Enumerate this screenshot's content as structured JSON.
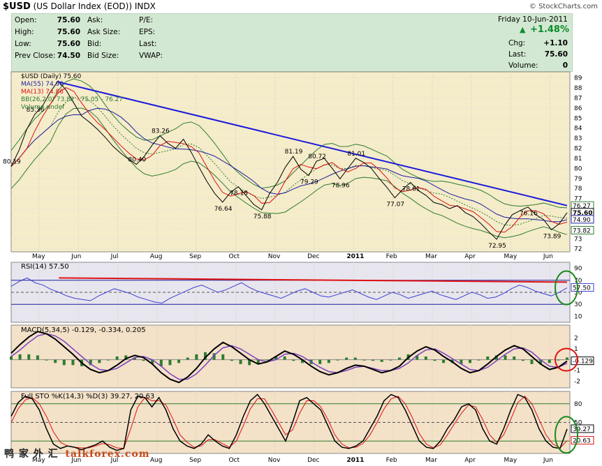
{
  "header": {
    "symbol": "$USD",
    "name": "(US Dollar Index (EOD))",
    "exchange": "INDX",
    "brand": "© StockCharts.com"
  },
  "quote": {
    "date": "Friday  10-Jun-2011",
    "open_label": "Open:",
    "open": "75.60",
    "high_label": "High:",
    "high": "75.60",
    "low_label": "Low:",
    "low": "75.60",
    "prev_close_label": "Prev Close:",
    "prev_close": "74.50",
    "ask_label": "Ask:",
    "ask_size_label": "Ask Size:",
    "bid_label": "Bid:",
    "bid_size_label": "Bid Size:",
    "pe_label": "P/E:",
    "eps_label": "EPS:",
    "last_label_mid": "Last:",
    "vwap_label": "VWAP:",
    "chg_pct": "+1.48%",
    "chg_label": "Chg:",
    "chg": "+1.10",
    "last_label": "Last:",
    "last": "75.60",
    "volume_label": "Volume:",
    "volume": "0"
  },
  "chart_data": [
    {
      "type": "line",
      "panel": "price",
      "legend": [
        "$USD (Daily) 75.60",
        "MA(55) 74.90",
        "MA(13) 74.86",
        "BB(26,2.0) 73.82 - 75.05 - 76.27",
        "Volume undef"
      ],
      "x_ticks": [
        "May",
        "Jun",
        "Jul",
        "Aug",
        "Sep",
        "Oct",
        "Nov",
        "Dec",
        "2011",
        "Feb",
        "Mar",
        "Apr",
        "May",
        "Jun"
      ],
      "y_ticks": [
        72,
        73,
        74,
        75,
        76,
        77,
        78,
        79,
        80,
        81,
        82,
        83,
        84,
        85,
        86,
        87,
        88,
        89
      ],
      "ylim": [
        71.7,
        89.6
      ],
      "price": [
        80.19,
        81.8,
        83.9,
        85.36,
        86.2,
        87.6,
        88.7,
        87.8,
        86.5,
        85.2,
        84.6,
        83.9,
        83.1,
        82.2,
        81.5,
        80.9,
        80.4,
        81.2,
        82.3,
        83.26,
        82.5,
        82.0,
        82.9,
        81.6,
        80.1,
        78.7,
        77.5,
        76.64,
        77.6,
        78.18,
        77.3,
        76.4,
        75.88,
        77.5,
        78.6,
        80.1,
        81.19,
        79.9,
        79.29,
        80.72,
        81.0,
        80.0,
        78.96,
        80.0,
        81.01,
        80.6,
        80.0,
        79.0,
        78.1,
        77.07,
        77.9,
        78.61,
        77.8,
        77.3,
        76.6,
        76.4,
        76.0,
        76.3,
        75.6,
        75.2,
        74.5,
        73.7,
        72.95,
        74.3,
        75.4,
        75.8,
        76.16,
        75.4,
        74.9,
        73.89,
        74.5,
        75.6
      ],
      "annotations": [
        {
          "x": 0,
          "y": 80.19,
          "text": "80.19"
        },
        {
          "x": 3,
          "y": 85.36,
          "text": "85.36"
        },
        {
          "x": 16,
          "y": 80.4,
          "text": "80.40"
        },
        {
          "x": 19,
          "y": 83.26,
          "text": "83.26"
        },
        {
          "x": 27,
          "y": 76.64,
          "text": "76.64"
        },
        {
          "x": 29,
          "y": 78.18,
          "text": "78.18"
        },
        {
          "x": 32,
          "y": 75.88,
          "text": "75.88"
        },
        {
          "x": 36,
          "y": 81.19,
          "text": "81.19"
        },
        {
          "x": 38,
          "y": 79.29,
          "text": "79.29"
        },
        {
          "x": 39,
          "y": 80.72,
          "text": "80.72"
        },
        {
          "x": 42,
          "y": 78.96,
          "text": "78.96"
        },
        {
          "x": 44,
          "y": 81.01,
          "text": "81.01"
        },
        {
          "x": 49,
          "y": 77.07,
          "text": "77.07"
        },
        {
          "x": 51,
          "y": 78.61,
          "text": "78.61"
        },
        {
          "x": 62,
          "y": 72.95,
          "text": "72.95"
        },
        {
          "x": 66,
          "y": 76.16,
          "text": "76.16"
        },
        {
          "x": 69,
          "y": 73.89,
          "text": "73.89"
        }
      ],
      "right_labels": [
        "76.27",
        "75.60",
        "74.90",
        "73.82"
      ],
      "trendline": [
        [
          6,
          88.6
        ],
        [
          71,
          76.3
        ]
      ]
    },
    {
      "type": "line",
      "panel": "rsi",
      "legend": "RSI(14) 57.50",
      "y_ticks": [
        10,
        30,
        50,
        70,
        90
      ],
      "ylim": [
        0,
        100
      ],
      "values": [
        60,
        68,
        74,
        66,
        62,
        55,
        50,
        44,
        40,
        38,
        36,
        44,
        50,
        56,
        52,
        48,
        42,
        38,
        34,
        32,
        40,
        46,
        52,
        58,
        62,
        56,
        50,
        54,
        60,
        66,
        58,
        52,
        48,
        44,
        40,
        46,
        52,
        56,
        50,
        44,
        42,
        46,
        50,
        54,
        48,
        42,
        38,
        44,
        50,
        46,
        40,
        44,
        48,
        52,
        46,
        42,
        38,
        44,
        50,
        46,
        40,
        42,
        48,
        56,
        62,
        58,
        52,
        48,
        44,
        50,
        57.5
      ],
      "value_label": "57.50"
    },
    {
      "type": "line",
      "panel": "macd",
      "legend": [
        "MACD(5,34,5) -0.129, -0.334, 0.205"
      ],
      "y_ticks": [
        -2,
        -1,
        0,
        1,
        2
      ],
      "ylim": [
        -2.6,
        3.2
      ],
      "macd": [
        0.6,
        1.4,
        2.1,
        2.6,
        2.4,
        1.9,
        1.2,
        0.5,
        -0.3,
        -0.9,
        -1.2,
        -1.0,
        -0.5,
        0.1,
        0.4,
        0.2,
        -0.4,
        -1.2,
        -1.8,
        -2.1,
        -1.6,
        -0.8,
        0.2,
        1.0,
        1.6,
        1.2,
        0.6,
        0.0,
        -0.4,
        -0.2,
        0.3,
        0.8,
        0.5,
        0.0,
        -0.6,
        -1.1,
        -1.4,
        -1.2,
        -0.8,
        -0.5,
        -0.6,
        -0.9,
        -1.2,
        -1.0,
        -0.6,
        0.2,
        0.8,
        1.2,
        0.9,
        0.3,
        -0.2,
        -0.8,
        -1.2,
        -1.0,
        -0.4,
        0.3,
        0.9,
        1.3,
        1.0,
        0.3,
        -0.4,
        -0.9,
        -0.7,
        -0.129
      ],
      "signal": [
        0.3,
        0.9,
        1.6,
        2.2,
        2.4,
        2.2,
        1.7,
        1.0,
        0.3,
        -0.4,
        -0.9,
        -1.0,
        -0.8,
        -0.3,
        0.2,
        0.3,
        0.0,
        -0.6,
        -1.3,
        -1.8,
        -1.8,
        -1.3,
        -0.5,
        0.4,
        1.1,
        1.3,
        1.0,
        0.5,
        0.0,
        -0.2,
        0.0,
        0.5,
        0.6,
        0.3,
        -0.2,
        -0.7,
        -1.1,
        -1.2,
        -1.0,
        -0.7,
        -0.6,
        -0.8,
        -1.0,
        -1.0,
        -0.8,
        -0.3,
        0.4,
        0.9,
        1.0,
        0.6,
        0.1,
        -0.4,
        -0.9,
        -1.0,
        -0.7,
        -0.1,
        0.5,
        1.0,
        1.1,
        0.7,
        0.0,
        -0.6,
        -0.7,
        -0.334
      ],
      "value_label": "-0.129"
    },
    {
      "type": "line",
      "panel": "stochastic",
      "legend": "Full STO %K(14,3) %D(3) 39.27, 20.63",
      "y_ticks": [
        20,
        50,
        80
      ],
      "ylim": [
        0,
        100
      ],
      "k": [
        60,
        82,
        92,
        88,
        70,
        40,
        15,
        8,
        12,
        10,
        6,
        10,
        14,
        20,
        10,
        5,
        8,
        70,
        92,
        90,
        75,
        90,
        70,
        40,
        20,
        12,
        8,
        15,
        30,
        20,
        12,
        8,
        30,
        60,
        85,
        95,
        80,
        60,
        40,
        20,
        50,
        85,
        90,
        80,
        70,
        45,
        20,
        10,
        8,
        12,
        20,
        40,
        60,
        85,
        95,
        90,
        70,
        45,
        20,
        10,
        8,
        20,
        40,
        55,
        75,
        80,
        70,
        40,
        20,
        15,
        40,
        70,
        95,
        90,
        70,
        40,
        20,
        10,
        8,
        39.27
      ],
      "d": [
        50,
        72,
        86,
        90,
        80,
        60,
        35,
        18,
        12,
        10,
        9,
        9,
        12,
        16,
        14,
        9,
        8,
        40,
        75,
        90,
        85,
        85,
        78,
        55,
        30,
        18,
        10,
        12,
        22,
        22,
        16,
        10,
        20,
        45,
        72,
        88,
        88,
        70,
        50,
        30,
        38,
        65,
        85,
        85,
        75,
        55,
        30,
        15,
        9,
        10,
        16,
        30,
        50,
        72,
        88,
        92,
        80,
        58,
        32,
        15,
        9,
        14,
        30,
        48,
        65,
        78,
        75,
        55,
        30,
        18,
        30,
        55,
        82,
        92,
        80,
        55,
        30,
        15,
        9,
        20.63
      ],
      "value_labels": [
        "39.27",
        "20.63"
      ]
    }
  ],
  "watermark": {
    "cn": "鸭 家 外 汇",
    "en": "talkforex.com"
  }
}
